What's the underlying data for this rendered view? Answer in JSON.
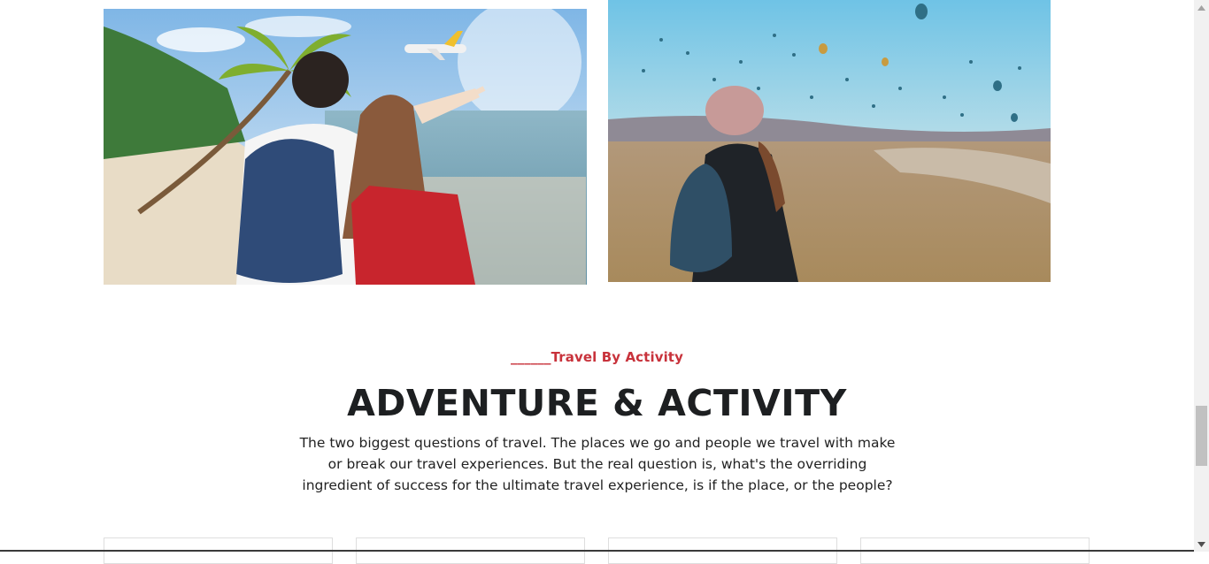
{
  "images": {
    "beach": {
      "alt": "Couple with backpacks on a tropical beach pointing at an airplane"
    },
    "balloons": {
      "alt": "Traveler in a beanie watching hot air balloons over a valley"
    }
  },
  "section": {
    "kicker_lead": "______",
    "kicker": "Travel By Activity",
    "title": "ADVENTURE & ACTIVITY",
    "description": "The two biggest questions of travel. The places we go and people we travel with make or break our travel experiences. But the real question is, what's the overriding ingredient of success for the ultimate travel experience, is if the place, or the people?"
  },
  "cards": [
    {
      "id": "card-1"
    },
    {
      "id": "card-2"
    },
    {
      "id": "card-3"
    },
    {
      "id": "card-4"
    }
  ],
  "icons": {
    "scroll_up": "chevron-up-icon",
    "scroll_down": "chevron-down-icon"
  },
  "colors": {
    "accent": "#c8323b",
    "heading": "#1d1f21",
    "body_text": "#222222"
  },
  "scroll": {
    "position_fraction": 0.82
  }
}
